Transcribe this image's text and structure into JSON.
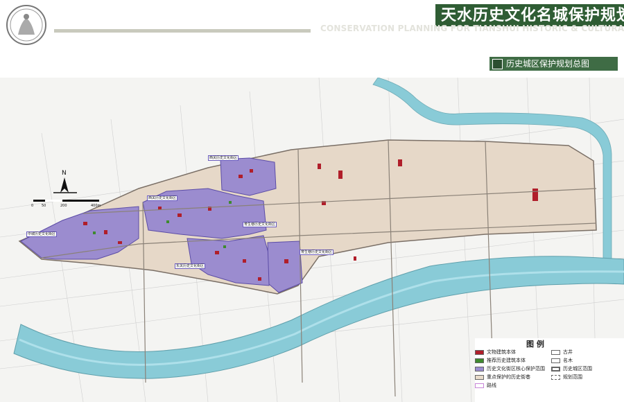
{
  "header": {
    "title_cn": "天水历史文化名城保护规划",
    "title_en": "CONSERVATION PLANNING FOR TIANSHUI HISTORIC & CULTURAL CITY",
    "subtitle": "历史城区保护规划总图"
  },
  "north_label": "N",
  "scale_labels": [
    "0",
    "50",
    "200",
    "400m"
  ],
  "zone_labels": [
    "西关历史文化街区",
    "西关历史文化街区",
    "中城历史文化街区",
    "育生巷历史文化街区",
    "东关历史文化街区",
    "育生巷历史文化街区"
  ],
  "legend": {
    "title": "图 例",
    "items": [
      {
        "label": "文物建筑本体",
        "color": "#b01e2a"
      },
      {
        "label": "推荐历史建筑本体",
        "color": "#3e8a2e"
      },
      {
        "label": "历史文化街区核心保护范围",
        "color": "#9b8ccf"
      },
      {
        "label": "重点保护的历史街巷",
        "color": "#e9dccb"
      },
      {
        "label": "路线",
        "color": "#c985d9"
      },
      {
        "label": "古井",
        "color": "#ffffff"
      },
      {
        "label": "名木",
        "color": "#ffffff"
      },
      {
        "label": "历史城区范围",
        "color": "#ffffff"
      },
      {
        "label": "规划范围",
        "color": "#ffffff"
      }
    ]
  },
  "colors": {
    "river": "#89cbd7",
    "historic_district": "#9b8ccf",
    "old_city": "#e6d8c8",
    "heritage": "#b01e2a",
    "recommended": "#3e8a2e",
    "title_bar": "#2f5d34"
  }
}
